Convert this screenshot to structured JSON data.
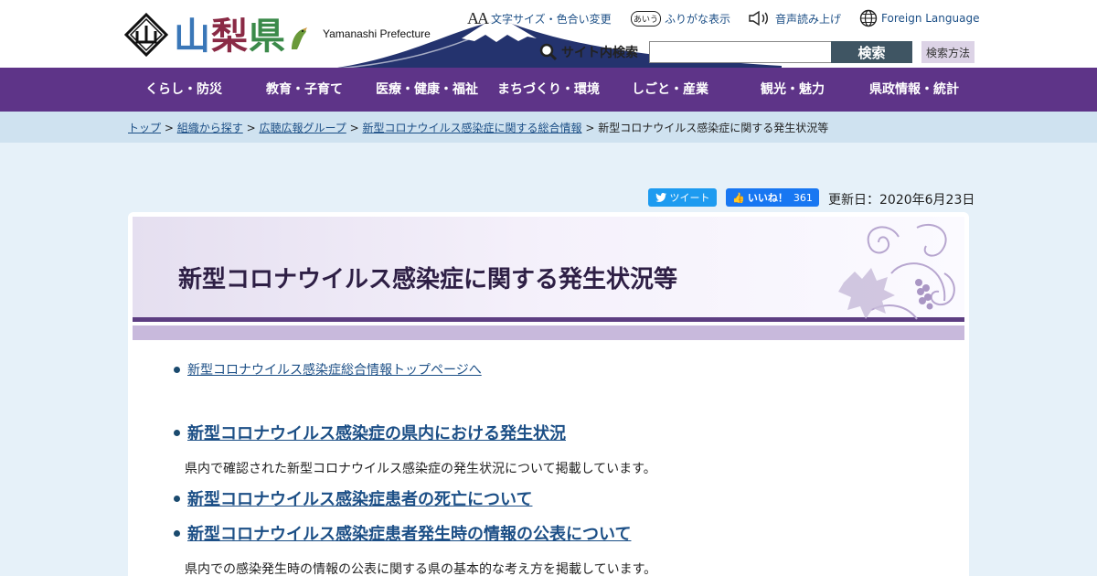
{
  "header": {
    "logo_chars": [
      "山",
      "梨",
      "県"
    ],
    "logo_sub": "Yamanashi Prefecture",
    "utilities": [
      {
        "icon": "font-size-icon",
        "label": "文字サイズ・色合い変更"
      },
      {
        "icon": "furigana-icon",
        "label": "ふりがな表示"
      },
      {
        "icon": "speaker-icon",
        "label": "音声読み上げ"
      },
      {
        "icon": "globe-icon",
        "label": "Foreign Language"
      }
    ],
    "icon_glyphs": {
      "font_size": "AA",
      "furigana": "あいう"
    },
    "search": {
      "label": "サイト内検索",
      "value": "",
      "button": "検索",
      "help": "検索方法"
    }
  },
  "nav": {
    "items": [
      "くらし・防災",
      "教育・子育て",
      "医療・健康・福祉",
      "まちづくり・環境",
      "しごと・産業",
      "観光・魅力",
      "県政情報・統計"
    ]
  },
  "breadcrumb": {
    "items": [
      "トップ",
      "組織から探す",
      "広聴広報グループ",
      "新型コロナウイルス感染症に関する総合情報"
    ],
    "current": "新型コロナウイルス感染症に関する発生状況等",
    "separator": ">"
  },
  "share": {
    "tweet": "ツイート",
    "like": "いいね！",
    "like_count": "361"
  },
  "updated": "更新日：2020年6月23日",
  "main": {
    "title": "新型コロナウイルス感染症に関する発生状況等",
    "top_link": "新型コロナウイルス感染症総合情報トップページへ",
    "sections": [
      {
        "link": "新型コロナウイルス感染症の県内における発生状況",
        "desc": "県内で確認された新型コロナウイルス感染症の発生状況について掲載しています。"
      },
      {
        "link": "新型コロナウイルス感染症患者の死亡について",
        "desc": ""
      },
      {
        "link": "新型コロナウイルス感染症患者発生時の情報の公表について",
        "desc": "県内での感染発生時の情報の公表に関する県の基本的な考え方を掲載しています。"
      }
    ]
  },
  "colors": {
    "nav": "#5e3488",
    "breadcrumb_bg": "#cfe2f0",
    "page_bg": "#e6f1f9",
    "link": "#1c4f86",
    "title_border": "#5d3e82"
  }
}
